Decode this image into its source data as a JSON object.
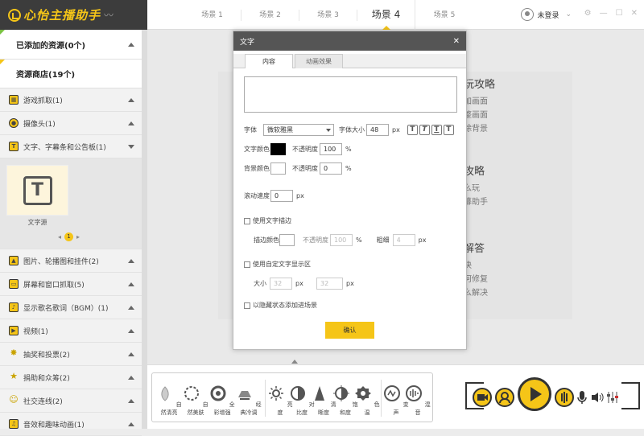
{
  "app": {
    "logo_text": "心怡主播助手"
  },
  "scenes": [
    "场景 1",
    "场景 2",
    "场景 3",
    "场景 4",
    "场景 5"
  ],
  "active_scene_index": 3,
  "user": {
    "status": "未登录"
  },
  "sidebar": {
    "added_header": "已添加的资源(0个)",
    "store_header": "资源商店(19个)",
    "items": [
      {
        "icon": "game-icon",
        "label": "游戏抓取(1)",
        "expanded": false
      },
      {
        "icon": "camera-icon",
        "label": "摄像头(1)",
        "expanded": false
      },
      {
        "icon": "text-icon",
        "label": "文字、字幕条和公告板(1)",
        "expanded": true
      },
      {
        "icon": "image-icon",
        "label": "图片、轮播图和挂件(2)",
        "expanded": false
      },
      {
        "icon": "screen-icon",
        "label": "屏幕和窗口抓取(5)",
        "expanded": false
      },
      {
        "icon": "music-icon",
        "label": "显示歌名歌词（BGM）(1)",
        "expanded": false
      },
      {
        "icon": "video-icon",
        "label": "视频(1)",
        "expanded": false
      },
      {
        "icon": "lottery-icon",
        "label": "抽奖和投票(2)",
        "expanded": false
      },
      {
        "icon": "donate-icon",
        "label": "捐助和众筹(2)",
        "expanded": false
      },
      {
        "icon": "social-icon",
        "label": "社交连线(2)",
        "expanded": false
      },
      {
        "icon": "sound-icon",
        "label": "音效和趣味动画(1)",
        "expanded": false
      }
    ],
    "expanded_source": {
      "label": "文字源",
      "page": "1"
    }
  },
  "help_panel": {
    "sections": [
      {
        "title": "新手攻略",
        "lines": [
          "如何添加画面",
          "如何调整画面",
          "如何抠除背景"
        ]
      },
      {
        "title": "进阶攻略",
        "lines": [
          "录制怎么玩",
          "使用弹幕助手"
        ]
      },
      {
        "title": "常见解答",
        "lines": [
          "画面黑屏解决",
          "声音异常如何修复",
          "直播卡顿怎么解决"
        ]
      }
    ],
    "visible_fragments": [
      [
        "玩攻略",
        "加画面",
        "整画面",
        "除背景"
      ],
      [
        "攻略",
        "么玩",
        "幕助手"
      ],
      [
        "解答",
        "决",
        "何修复",
        "么解决"
      ]
    ]
  },
  "dialog": {
    "title": "文字",
    "tabs": [
      "内容",
      "动画效果"
    ],
    "active_tab": 0,
    "text_value": "",
    "font_label": "字体",
    "font_value": "微软雅黑",
    "size_label": "字体大小",
    "size_value": "48",
    "unit_px": "px",
    "unit_pct": "%",
    "style_buttons": [
      "T",
      "T",
      "T",
      "T"
    ],
    "text_color_label": "文字颜色",
    "text_color": "#000000",
    "opacity_label": "不透明度",
    "text_opacity": "100",
    "bg_color_label": "背景颜色",
    "bg_color": "#ffffff",
    "bg_opacity": "0",
    "scroll_label": "滚动速度",
    "scroll_value": "0",
    "stroke_check_label": "使用文字描边",
    "stroke_color_label": "描边颜色",
    "stroke_opacity": "100",
    "thickness_label": "粗细",
    "thickness_value": "4",
    "custom_area_label": "使用自定文字显示区",
    "area_size_label": "大小",
    "area_w": "32",
    "area_h": "32",
    "hidden_add_label": "以隐藏状态添加进场景",
    "ok_label": "确认"
  },
  "bottom": {
    "effects": [
      {
        "icon": "nature-icon",
        "label": "自然清亮"
      },
      {
        "icon": "beauty-icon",
        "label": "自然美肤"
      },
      {
        "icon": "enhance-icon",
        "label": "全彩增强"
      },
      {
        "icon": "classic-icon",
        "label": "经典冷调"
      },
      {
        "icon": "brightness-icon",
        "label": "亮度"
      },
      {
        "icon": "contrast-icon",
        "label": "对比度"
      },
      {
        "icon": "sharpness-icon",
        "label": "清晰度"
      },
      {
        "icon": "saturation-icon",
        "label": "饱和度"
      },
      {
        "icon": "color-temp-icon",
        "label": "色温"
      },
      {
        "icon": "voice-change-icon",
        "label": "变声"
      },
      {
        "icon": "reverb-icon",
        "label": "混音"
      }
    ]
  },
  "colors": {
    "accent": "#f5c518",
    "dark": "#3c3c3c"
  }
}
